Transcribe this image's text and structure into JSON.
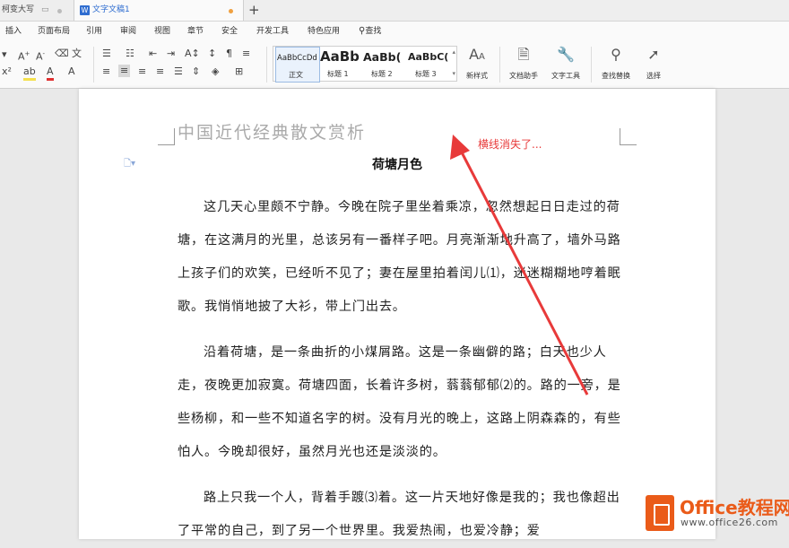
{
  "tabs": {
    "inactive": "柯变大写",
    "active": "文字文稿1",
    "new_tab": "+"
  },
  "menu": [
    "插入",
    "页面布局",
    "引用",
    "审阅",
    "视图",
    "章节",
    "安全",
    "开发工具",
    "特色应用",
    "查找"
  ],
  "styles": [
    {
      "preview": "AaBbCcDd",
      "label": "正文"
    },
    {
      "preview": "AaBb",
      "label": "标题 1"
    },
    {
      "preview": "AaBb(",
      "label": "标题 2"
    },
    {
      "preview": "AaBbC(",
      "label": "标题 3"
    }
  ],
  "tools": {
    "new_style": "新样式",
    "doc_helper": "文档助手",
    "text_tools": "文字工具",
    "find_replace": "查找替换",
    "select": "选择"
  },
  "document": {
    "header": "中国近代经典散文赏析",
    "title": "荷塘月色",
    "paragraphs": [
      "这几天心里颇不宁静。今晚在院子里坐着乘凉，忽然想起日日走过的荷塘，在这满月的光里，总该另有一番样子吧。月亮渐渐地升高了，墙外马路上孩子们的欢笑，已经听不见了；妻在屋里拍着闰儿⑴，迷迷糊糊地哼着眠歌。我悄悄地披了大衫，带上门出去。",
      "沿着荷塘，是一条曲折的小煤屑路。这是一条幽僻的路；白天也少人走，夜晚更加寂寞。荷塘四面，长着许多树，蓊蓊郁郁⑵的。路的一旁，是些杨柳，和一些不知道名字的树。没有月光的晚上，这路上阴森森的，有些怕人。今晚却很好，虽然月光也还是淡淡的。",
      "路上只我一个人，背着手踱⑶着。这一片天地好像是我的；我也像超出了平常的自己，到了另一个世界里。我爱热闹，也爱冷静；爱"
    ]
  },
  "annotation": "横线消失了...",
  "watermark": {
    "title": "Office教程网",
    "url": "www.office26.com"
  },
  "colors": {
    "accent_red": "#e83a3a",
    "tab_blue": "#2f6dd0",
    "logo_orange": "#ea5b19"
  }
}
